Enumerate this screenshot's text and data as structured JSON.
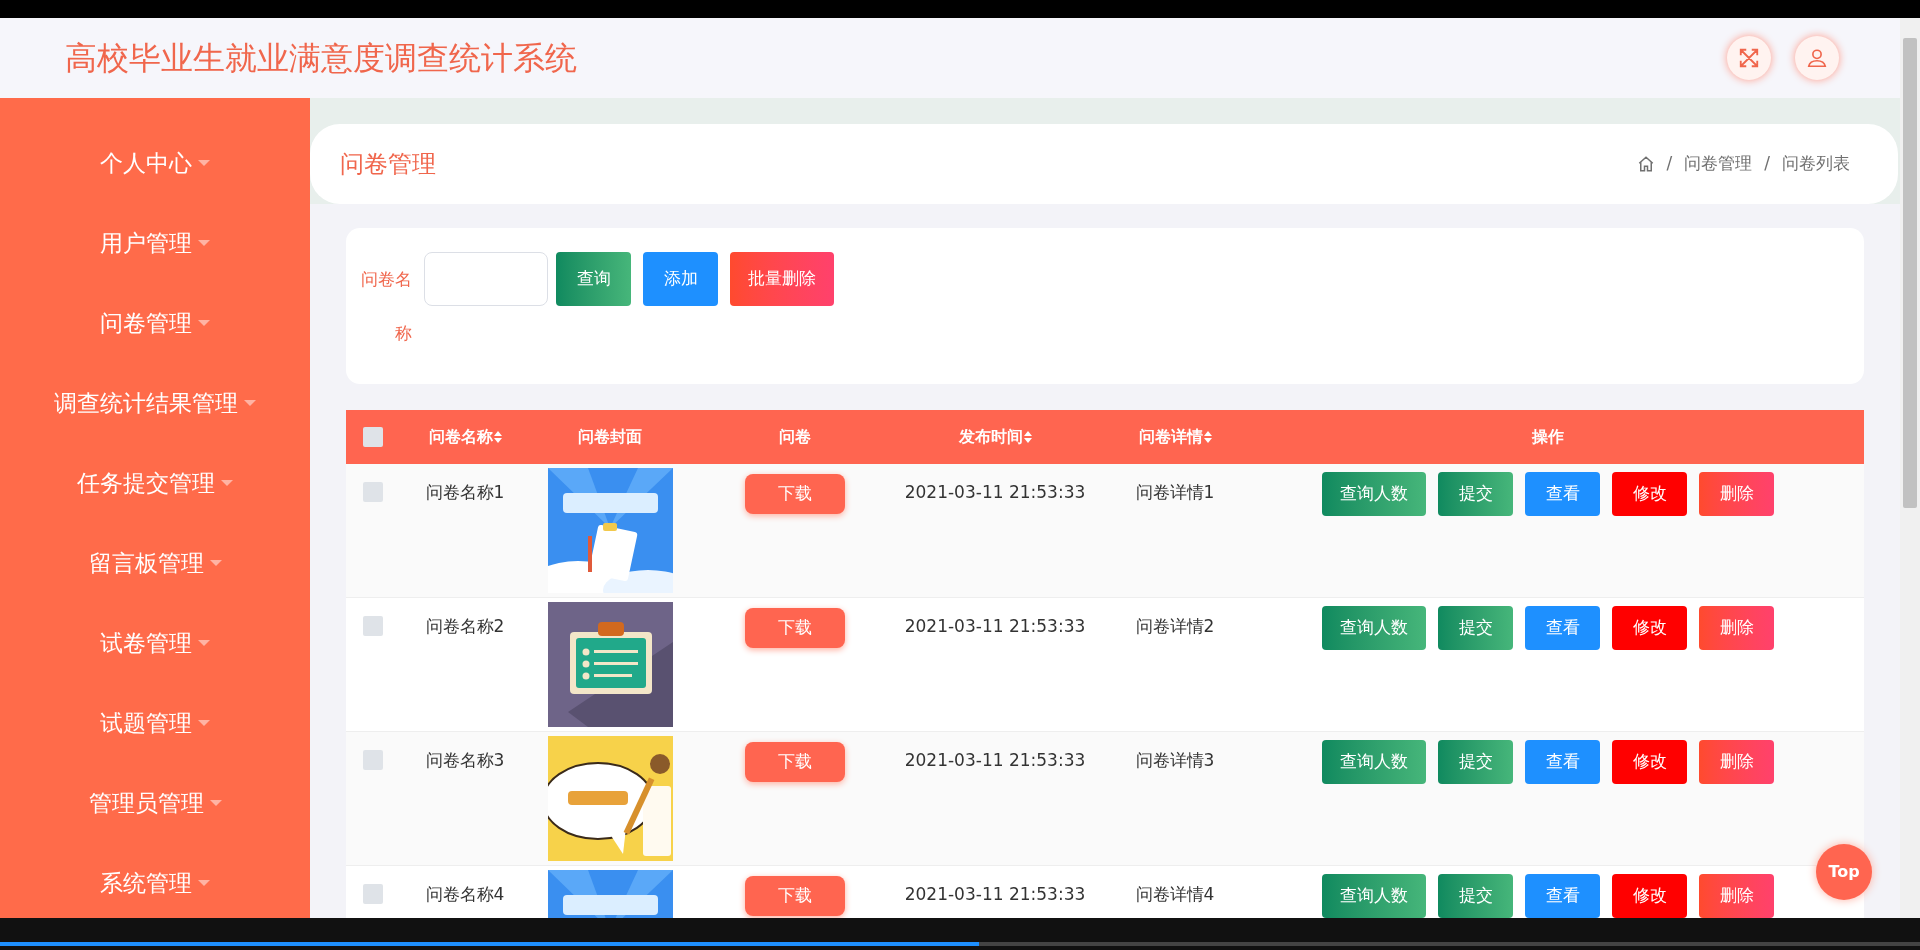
{
  "header": {
    "title": "高校毕业生就业满意度调查统计系统"
  },
  "sidebar": {
    "items": [
      {
        "label": "个人中心"
      },
      {
        "label": "用户管理"
      },
      {
        "label": "问卷管理"
      },
      {
        "label": "调查统计结果管理"
      },
      {
        "label": "任务提交管理"
      },
      {
        "label": "留言板管理"
      },
      {
        "label": "试卷管理"
      },
      {
        "label": "试题管理"
      },
      {
        "label": "管理员管理"
      },
      {
        "label": "系统管理"
      }
    ]
  },
  "page": {
    "title": "问卷管理",
    "breadcrumb": [
      {
        "separator": "/",
        "label": "问卷管理"
      },
      {
        "separator": "/",
        "label": "问卷列表"
      }
    ]
  },
  "search": {
    "label": "问卷名称",
    "buttons": [
      {
        "label": "查询",
        "kind": "green"
      },
      {
        "label": "添加",
        "kind": "blue"
      },
      {
        "label": "批量删除",
        "kind": "pink"
      }
    ]
  },
  "table": {
    "select_all": {
      "checked": false
    },
    "columns": [
      {
        "label": "问卷名称",
        "sortable": true
      },
      {
        "label": "问卷封面",
        "sortable": false
      },
      {
        "label": "问卷",
        "sortable": false
      },
      {
        "label": "发布时间",
        "sortable": true
      },
      {
        "label": "问卷详情",
        "sortable": true
      },
      {
        "label": "操作",
        "sortable": false
      }
    ],
    "rows": [
      {
        "checked": false,
        "name": "问卷名称1",
        "cover": {
          "kind": "picture"
        },
        "download": "下载",
        "time": "2021-03-11 21:53:33",
        "detail": "问卷详情1",
        "actions": [
          {
            "label": "查询人数",
            "kind": "green"
          },
          {
            "label": "提交",
            "kind": "green"
          },
          {
            "label": "查看",
            "kind": "blue"
          },
          {
            "label": "修改",
            "kind": "red"
          },
          {
            "label": "删除",
            "kind": "pink"
          }
        ]
      },
      {
        "checked": false,
        "name": "问卷名称2",
        "cover": {
          "kind": "picture"
        },
        "download": "下载",
        "time": "2021-03-11 21:53:33",
        "detail": "问卷详情2",
        "actions": [
          {
            "label": "查询人数",
            "kind": "green"
          },
          {
            "label": "提交",
            "kind": "green"
          },
          {
            "label": "查看",
            "kind": "blue"
          },
          {
            "label": "修改",
            "kind": "red"
          },
          {
            "label": "删除",
            "kind": "pink"
          }
        ]
      },
      {
        "checked": false,
        "name": "问卷名称3",
        "cover": {
          "kind": "picture"
        },
        "download": "下载",
        "time": "2021-03-11 21:53:33",
        "detail": "问卷详情3",
        "actions": [
          {
            "label": "查询人数",
            "kind": "green"
          },
          {
            "label": "提交",
            "kind": "green"
          },
          {
            "label": "查看",
            "kind": "blue"
          },
          {
            "label": "修改",
            "kind": "red"
          },
          {
            "label": "删除",
            "kind": "pink"
          }
        ]
      },
      {
        "checked": false,
        "name": "问卷名称4",
        "cover": {
          "kind": "picture"
        },
        "download": "下载",
        "time": "2021-03-11 21:53:33",
        "detail": "问卷详情4",
        "actions": [
          {
            "label": "查询人数",
            "kind": "green"
          },
          {
            "label": "提交",
            "kind": "green"
          },
          {
            "label": "查看",
            "kind": "blue"
          },
          {
            "label": "修改",
            "kind": "red"
          },
          {
            "label": "删除",
            "kind": "pink"
          }
        ]
      }
    ]
  },
  "top_button": {
    "label": "Top"
  },
  "player": {
    "level": 0.51
  }
}
